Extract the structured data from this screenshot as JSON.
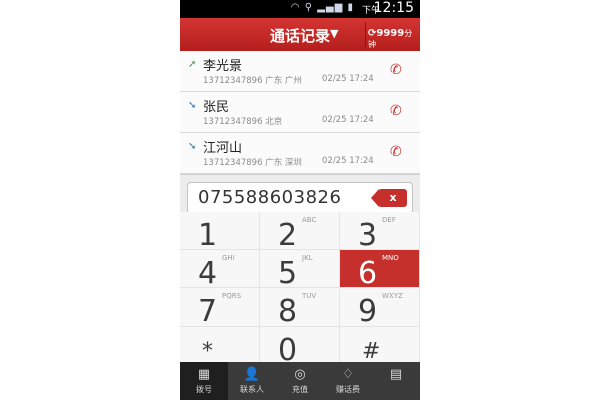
{
  "status_bar": {
    "icons": [
      "wifi-icon",
      "usb-icon",
      "signal-icon",
      "battery-icon"
    ],
    "ampm": "下午",
    "time": "12:15"
  },
  "title_bar": {
    "title": "通话记录",
    "balance": "9999",
    "balance_unit": "分钟"
  },
  "call_log": [
    {
      "direction": "outgoing",
      "name": "李光景",
      "number": "13712347896",
      "location": "广东 广州",
      "date": "02/25 17:24"
    },
    {
      "direction": "incoming",
      "name": "张民",
      "number": "13712347896",
      "location": "北京",
      "date": "02/25 17:24"
    },
    {
      "direction": "incoming",
      "name": "江河山",
      "number": "13712347896",
      "location": "广东 深圳",
      "date": "02/25 17:24"
    }
  ],
  "dial_input": {
    "value": "075588603826",
    "delete_label": "x"
  },
  "keypad": {
    "keys": [
      {
        "num": "1",
        "letters": ""
      },
      {
        "num": "2",
        "letters": "ABC"
      },
      {
        "num": "3",
        "letters": "DEF"
      },
      {
        "num": "4",
        "letters": "GHI"
      },
      {
        "num": "5",
        "letters": "JKL"
      },
      {
        "num": "6",
        "letters": "MNO"
      },
      {
        "num": "7",
        "letters": "PQRS"
      },
      {
        "num": "8",
        "letters": "TUV"
      },
      {
        "num": "9",
        "letters": "WXYZ"
      },
      {
        "num": "*",
        "letters": ""
      },
      {
        "num": "0",
        "letters": ""
      },
      {
        "num": "#",
        "letters": ""
      }
    ],
    "pressed_key": "6"
  },
  "bottom_nav": {
    "items": [
      {
        "label": "拨号",
        "icon": "dialpad-icon"
      },
      {
        "label": "联系人",
        "icon": "contacts-icon"
      },
      {
        "label": "充值",
        "icon": "recharge-icon"
      },
      {
        "label": "赚话费",
        "icon": "earn-credit-icon"
      },
      {
        "label": "",
        "icon": "more-grid-icon"
      }
    ],
    "active": "拨号"
  },
  "colors": {
    "accent": "#c5302d",
    "header": "#c8302c",
    "nav_bg": "#3a3a3a"
  }
}
